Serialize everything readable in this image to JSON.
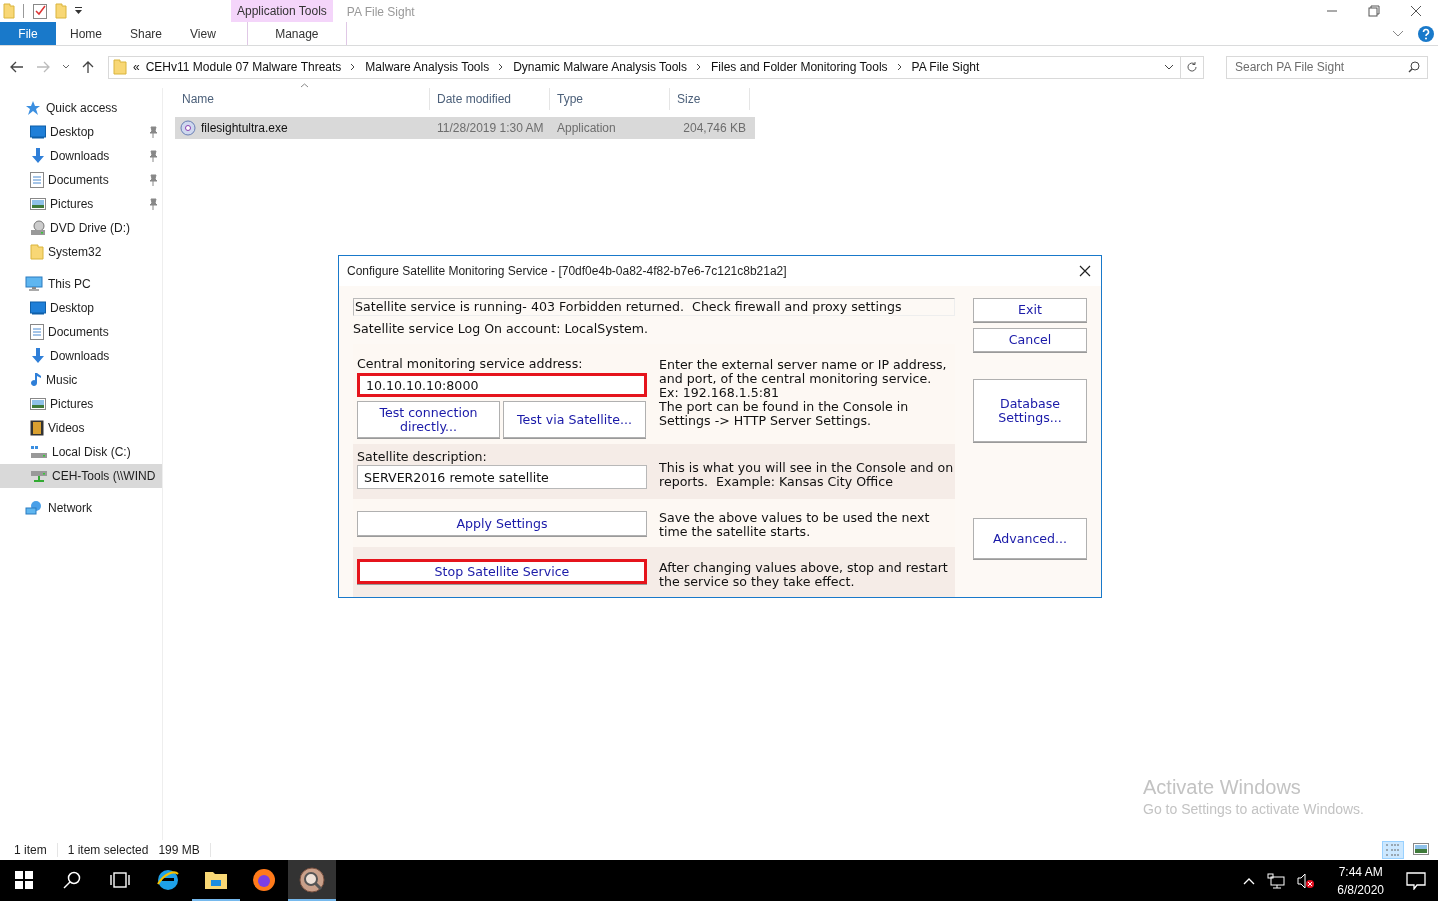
{
  "window": {
    "title": "PA File Sight"
  },
  "ribbon": {
    "contextual_group": "Application Tools",
    "tabs": [
      {
        "label": "File",
        "kind": "file"
      },
      {
        "label": "Home",
        "kind": "tab"
      },
      {
        "label": "Share",
        "kind": "tab"
      },
      {
        "label": "View",
        "kind": "tab"
      },
      {
        "label": "Manage",
        "kind": "contextual"
      }
    ]
  },
  "address_bar": {
    "overflow": "«",
    "path": [
      "CEHv11 Module 07 Malware Threats",
      "Malware Analysis Tools",
      "Dynamic Malware Analysis Tools",
      "Files and Folder Monitoring Tools",
      "PA File Sight"
    ]
  },
  "search": {
    "placeholder": "Search PA File Sight"
  },
  "navigation": [
    {
      "label": "Quick access",
      "kind": "star",
      "children": [
        {
          "label": "Desktop",
          "kind": "desktop",
          "pinned": true,
          "selected": false
        },
        {
          "label": "Downloads",
          "kind": "downloads",
          "pinned": true,
          "selected": false
        },
        {
          "label": "Documents",
          "kind": "documents",
          "pinned": true,
          "selected": false
        },
        {
          "label": "Pictures",
          "kind": "pictures",
          "pinned": true,
          "selected": false
        },
        {
          "label": "DVD Drive (D:)",
          "kind": "dvd",
          "pinned": false,
          "selected": false
        },
        {
          "label": "System32",
          "kind": "folder",
          "pinned": false,
          "selected": false
        }
      ]
    },
    {
      "label": "This PC",
      "kind": "pc",
      "children": [
        {
          "label": "Desktop",
          "kind": "desktop",
          "pinned": false,
          "selected": false
        },
        {
          "label": "Documents",
          "kind": "documents",
          "pinned": false,
          "selected": false
        },
        {
          "label": "Downloads",
          "kind": "downloads",
          "pinned": false,
          "selected": false
        },
        {
          "label": "Music",
          "kind": "music",
          "pinned": false,
          "selected": false
        },
        {
          "label": "Pictures",
          "kind": "pictures",
          "pinned": false,
          "selected": false
        },
        {
          "label": "Videos",
          "kind": "videos",
          "pinned": false,
          "selected": false
        },
        {
          "label": "Local Disk (C:)",
          "kind": "disk",
          "pinned": false,
          "selected": false
        },
        {
          "label": "CEH-Tools (\\\\WIND",
          "kind": "netdrive",
          "pinned": false,
          "selected": true
        }
      ]
    },
    {
      "label": "Network",
      "kind": "network"
    }
  ],
  "file_list": {
    "columns": [
      "Name",
      "Date modified",
      "Type",
      "Size"
    ],
    "rows": [
      {
        "name": "filesightultra.exe",
        "date_modified": "11/28/2019 1:30 AM",
        "type": "Application",
        "size": "204,746 KB",
        "selected": true
      }
    ]
  },
  "dialog": {
    "title": "Configure Satellite Monitoring Service - [70df0e4b-0a82-4f82-b7e6-7c121c8b21a2]",
    "status": "Satellite service is running- 403 Forbidden returned.  Check firewall and proxy settings",
    "logon": "Satellite service Log On account: LocalSystem.",
    "sections": [
      {
        "kind": "address",
        "label": "Central monitoring service address:",
        "value": "10.10.10.10:8000",
        "highlighted": true,
        "buttons": [
          "Test connection directly...",
          "Test via Satellite..."
        ],
        "help": "Enter the external server name or IP address, and port, of the central monitoring service.\nEx: 192.168.1.5:81\nThe port can be found in the Console in Settings -> HTTP Server Settings."
      },
      {
        "kind": "field",
        "label": "Satellite description:",
        "value": "SERVER2016 remote satellite",
        "highlighted": false,
        "help": "This is what you will see in the Console and on reports.  Example: Kansas City Office"
      },
      {
        "kind": "action",
        "button": "Apply Settings",
        "highlighted": false,
        "help": "Save the above values to be used the next time the satellite starts."
      },
      {
        "kind": "action",
        "button": "Stop Satellite Service",
        "highlighted": true,
        "help": "After changing values above, stop and restart the service so they take effect."
      }
    ],
    "side_buttons": [
      {
        "label": "Exit",
        "kind": "small"
      },
      {
        "label": "Cancel",
        "kind": "small"
      },
      {
        "label": "Database Settings...",
        "kind": "large"
      },
      {
        "label": "Advanced...",
        "kind": "medium"
      }
    ]
  },
  "activation_notice": {
    "title": "Activate Windows",
    "text": "Go to Settings to activate Windows."
  },
  "status_bar": {
    "item_count": "1 item",
    "selection": "1 item selected",
    "size": "199 MB"
  },
  "view_buttons": [
    {
      "kind": "details",
      "selected": true
    },
    {
      "kind": "large_icons",
      "selected": false
    }
  ],
  "taskbar": {
    "apps": [
      {
        "kind": "browser_e",
        "running": false,
        "selected": false
      },
      {
        "kind": "explorer",
        "running": true,
        "selected": false
      },
      {
        "kind": "firefox",
        "running": false,
        "selected": false
      },
      {
        "kind": "filesight",
        "running": true,
        "selected": true
      }
    ],
    "time": "7:44 AM",
    "date": "6/8/2020"
  }
}
